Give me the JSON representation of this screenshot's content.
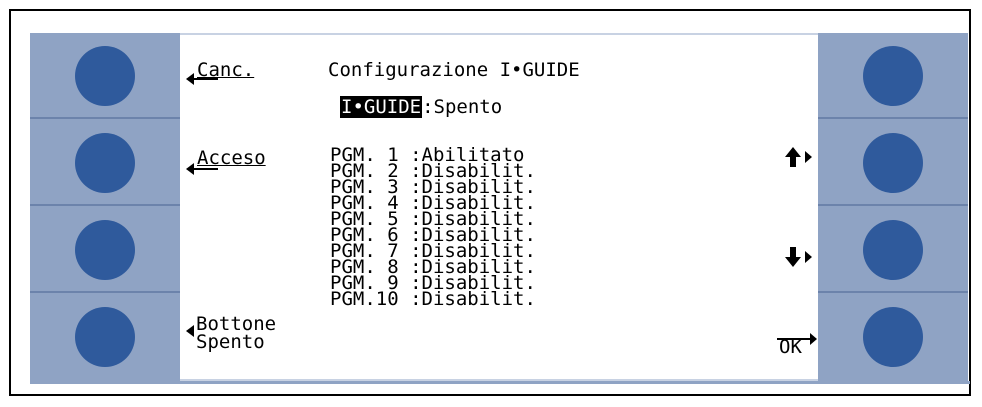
{
  "header": {
    "cancel_label": "Canc.",
    "title": "Configurazione I•GUIDE",
    "status_key": "I•GUIDE",
    "status_value": ":Spento"
  },
  "softkeys": {
    "on_label": "Acceso",
    "button_label_1": "Bottone",
    "button_label_2": "Spento",
    "ok_label": "OK"
  },
  "programs": [
    {
      "name": "PGM. 1",
      "state": ":Abilitato"
    },
    {
      "name": "PGM. 2",
      "state": ":Disabilit."
    },
    {
      "name": "PGM. 3",
      "state": ":Disabilit."
    },
    {
      "name": "PGM. 4",
      "state": ":Disabilit."
    },
    {
      "name": "PGM. 5",
      "state": ":Disabilit."
    },
    {
      "name": "PGM. 6",
      "state": ":Disabilit."
    },
    {
      "name": "PGM. 7",
      "state": ":Disabilit."
    },
    {
      "name": "PGM. 8",
      "state": ":Disabilit."
    },
    {
      "name": "PGM. 9",
      "state": ":Disabilit."
    },
    {
      "name": "PGM.10",
      "state": ":Disabilit."
    }
  ],
  "icons": {
    "up": "up-arrow-icon",
    "down": "down-arrow-icon"
  },
  "colors": {
    "panel": "#8fa3c4",
    "button": "#2f5a9c"
  }
}
